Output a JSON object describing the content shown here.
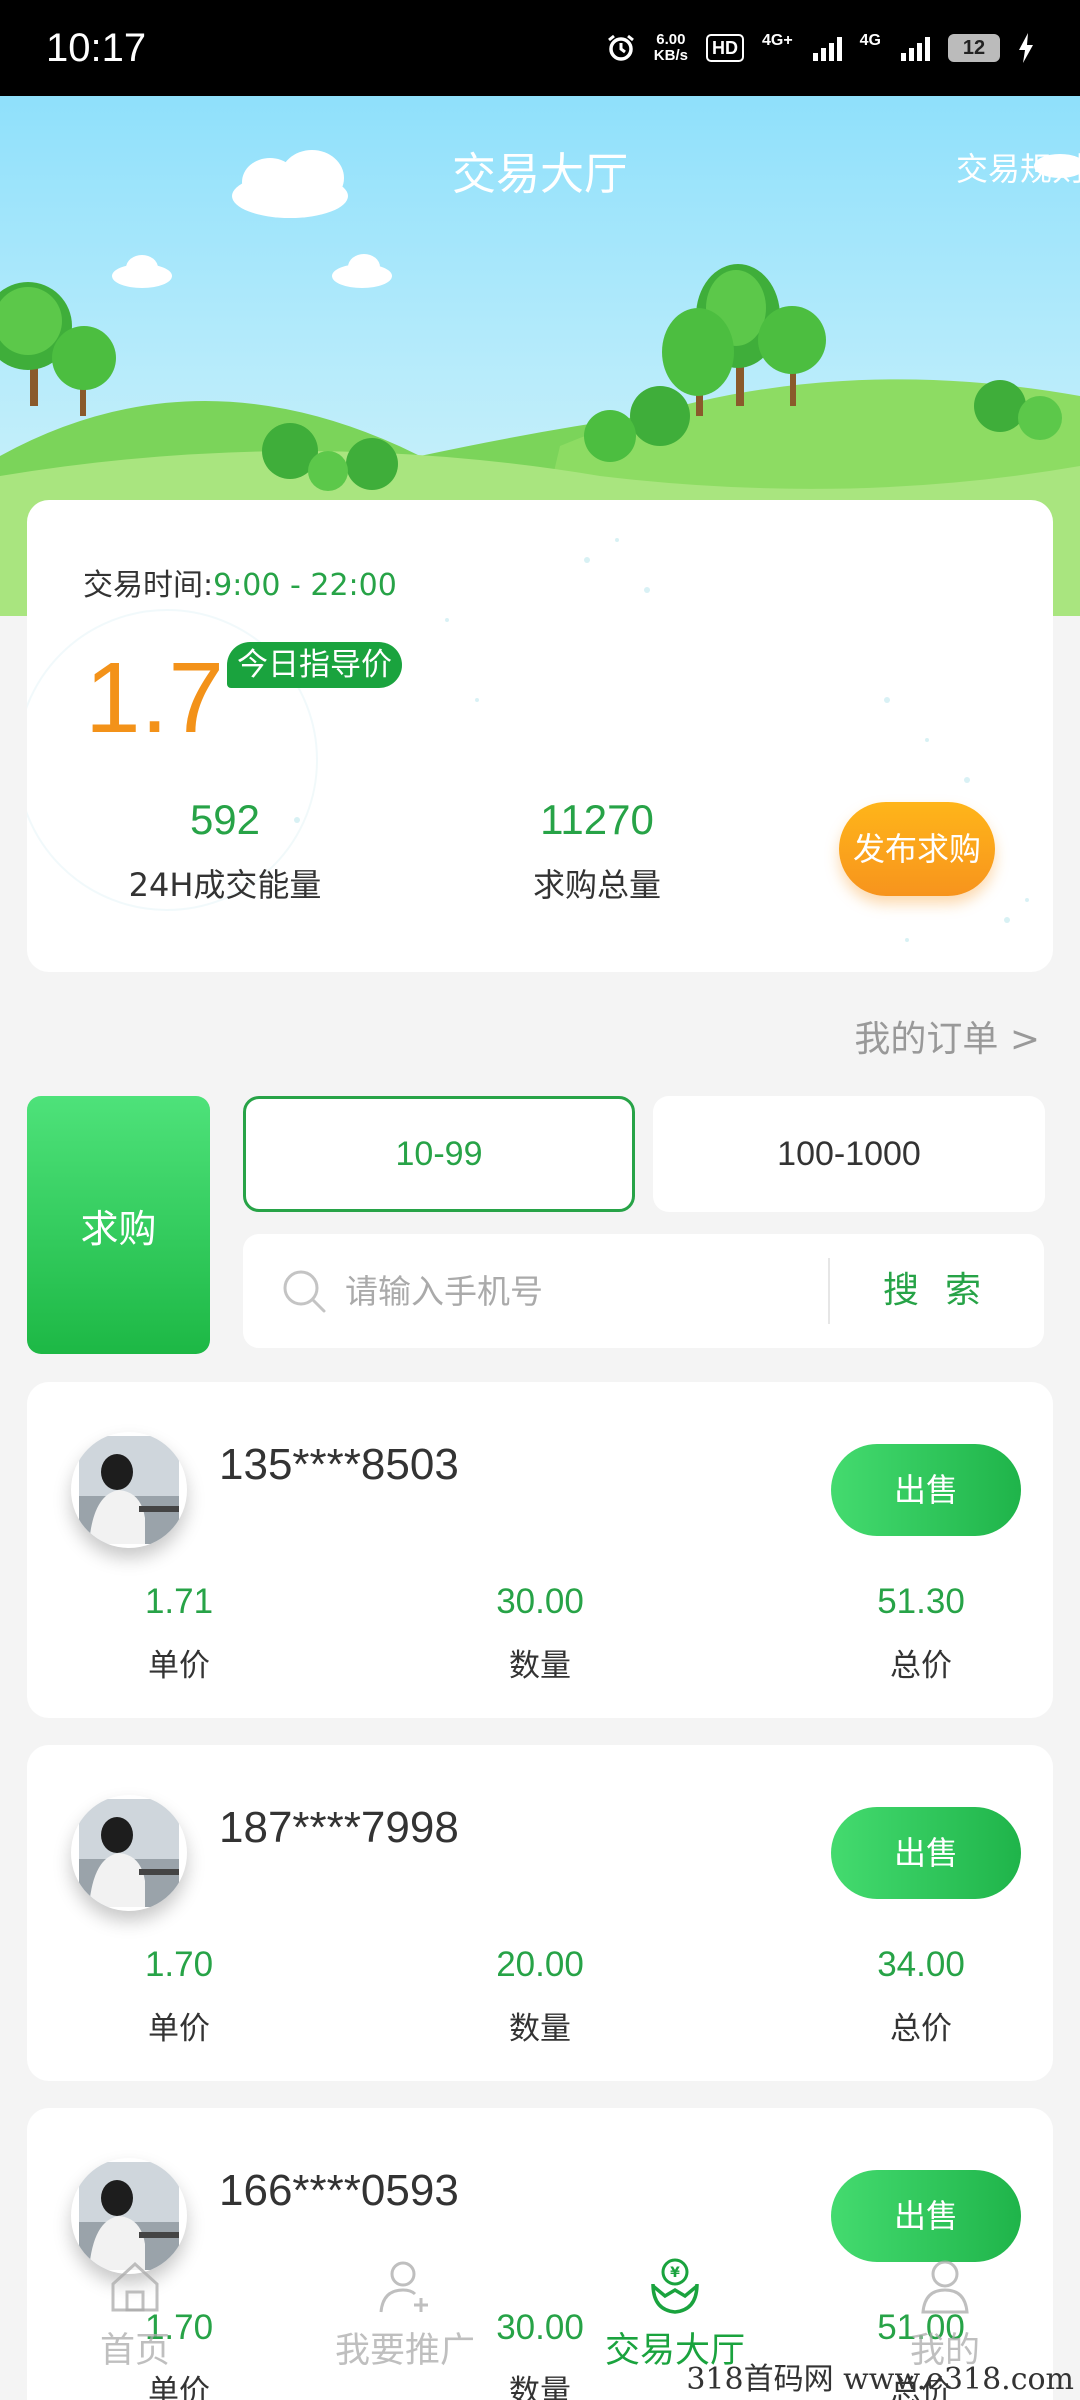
{
  "status_bar": {
    "time": "10:17",
    "speed_value": "6.00",
    "speed_unit": "KB/s",
    "hd": "HD",
    "net1": "4G+",
    "net2": "4G",
    "battery": "12"
  },
  "header": {
    "title": "交易大厅",
    "rules": "交易规则"
  },
  "summary": {
    "trade_time_label": "交易时间:",
    "trade_time_value": "9:00 - 22:00",
    "price": "1.7",
    "price_badge": "今日指导价",
    "volume_24h_value": "592",
    "volume_24h_label": "24H成交能量",
    "total_buy_value": "11270",
    "total_buy_label": "求购总量",
    "publish_button": "发布求购"
  },
  "my_orders_link": "我的订单 >",
  "filters": {
    "buy_tab": "求购",
    "ranges": [
      "10-99",
      "100-1000"
    ],
    "active_range": "10-99",
    "search_placeholder": "请输入手机号",
    "search_button": "搜索"
  },
  "orders": [
    {
      "phone": "135****8503",
      "unit_price": "1.71",
      "quantity": "30.00",
      "total": "51.30",
      "action": "出售",
      "unit_price_label": "单价",
      "quantity_label": "数量",
      "total_label": "总价"
    },
    {
      "phone": "187****7998",
      "unit_price": "1.70",
      "quantity": "20.00",
      "total": "34.00",
      "action": "出售",
      "unit_price_label": "单价",
      "quantity_label": "数量",
      "total_label": "总价"
    },
    {
      "phone": "166****0593",
      "unit_price": "1.70",
      "quantity": "30.00",
      "total": "51.00",
      "action": "出售",
      "unit_price_label": "单价",
      "quantity_label": "数量",
      "total_label": "总价"
    }
  ],
  "tabbar": {
    "items": [
      {
        "label": "首页",
        "icon": "home-icon"
      },
      {
        "label": "我要推广",
        "icon": "user-add-icon"
      },
      {
        "label": "交易大厅",
        "icon": "trade-hall-icon",
        "active": true
      },
      {
        "label": "我的",
        "icon": "profile-icon"
      }
    ]
  },
  "watermark": "318首码网 www.e318.com",
  "colors": {
    "brand_green": "#27a347",
    "accent_orange": "#f39219",
    "sky_blue": "#8fe0fb"
  }
}
